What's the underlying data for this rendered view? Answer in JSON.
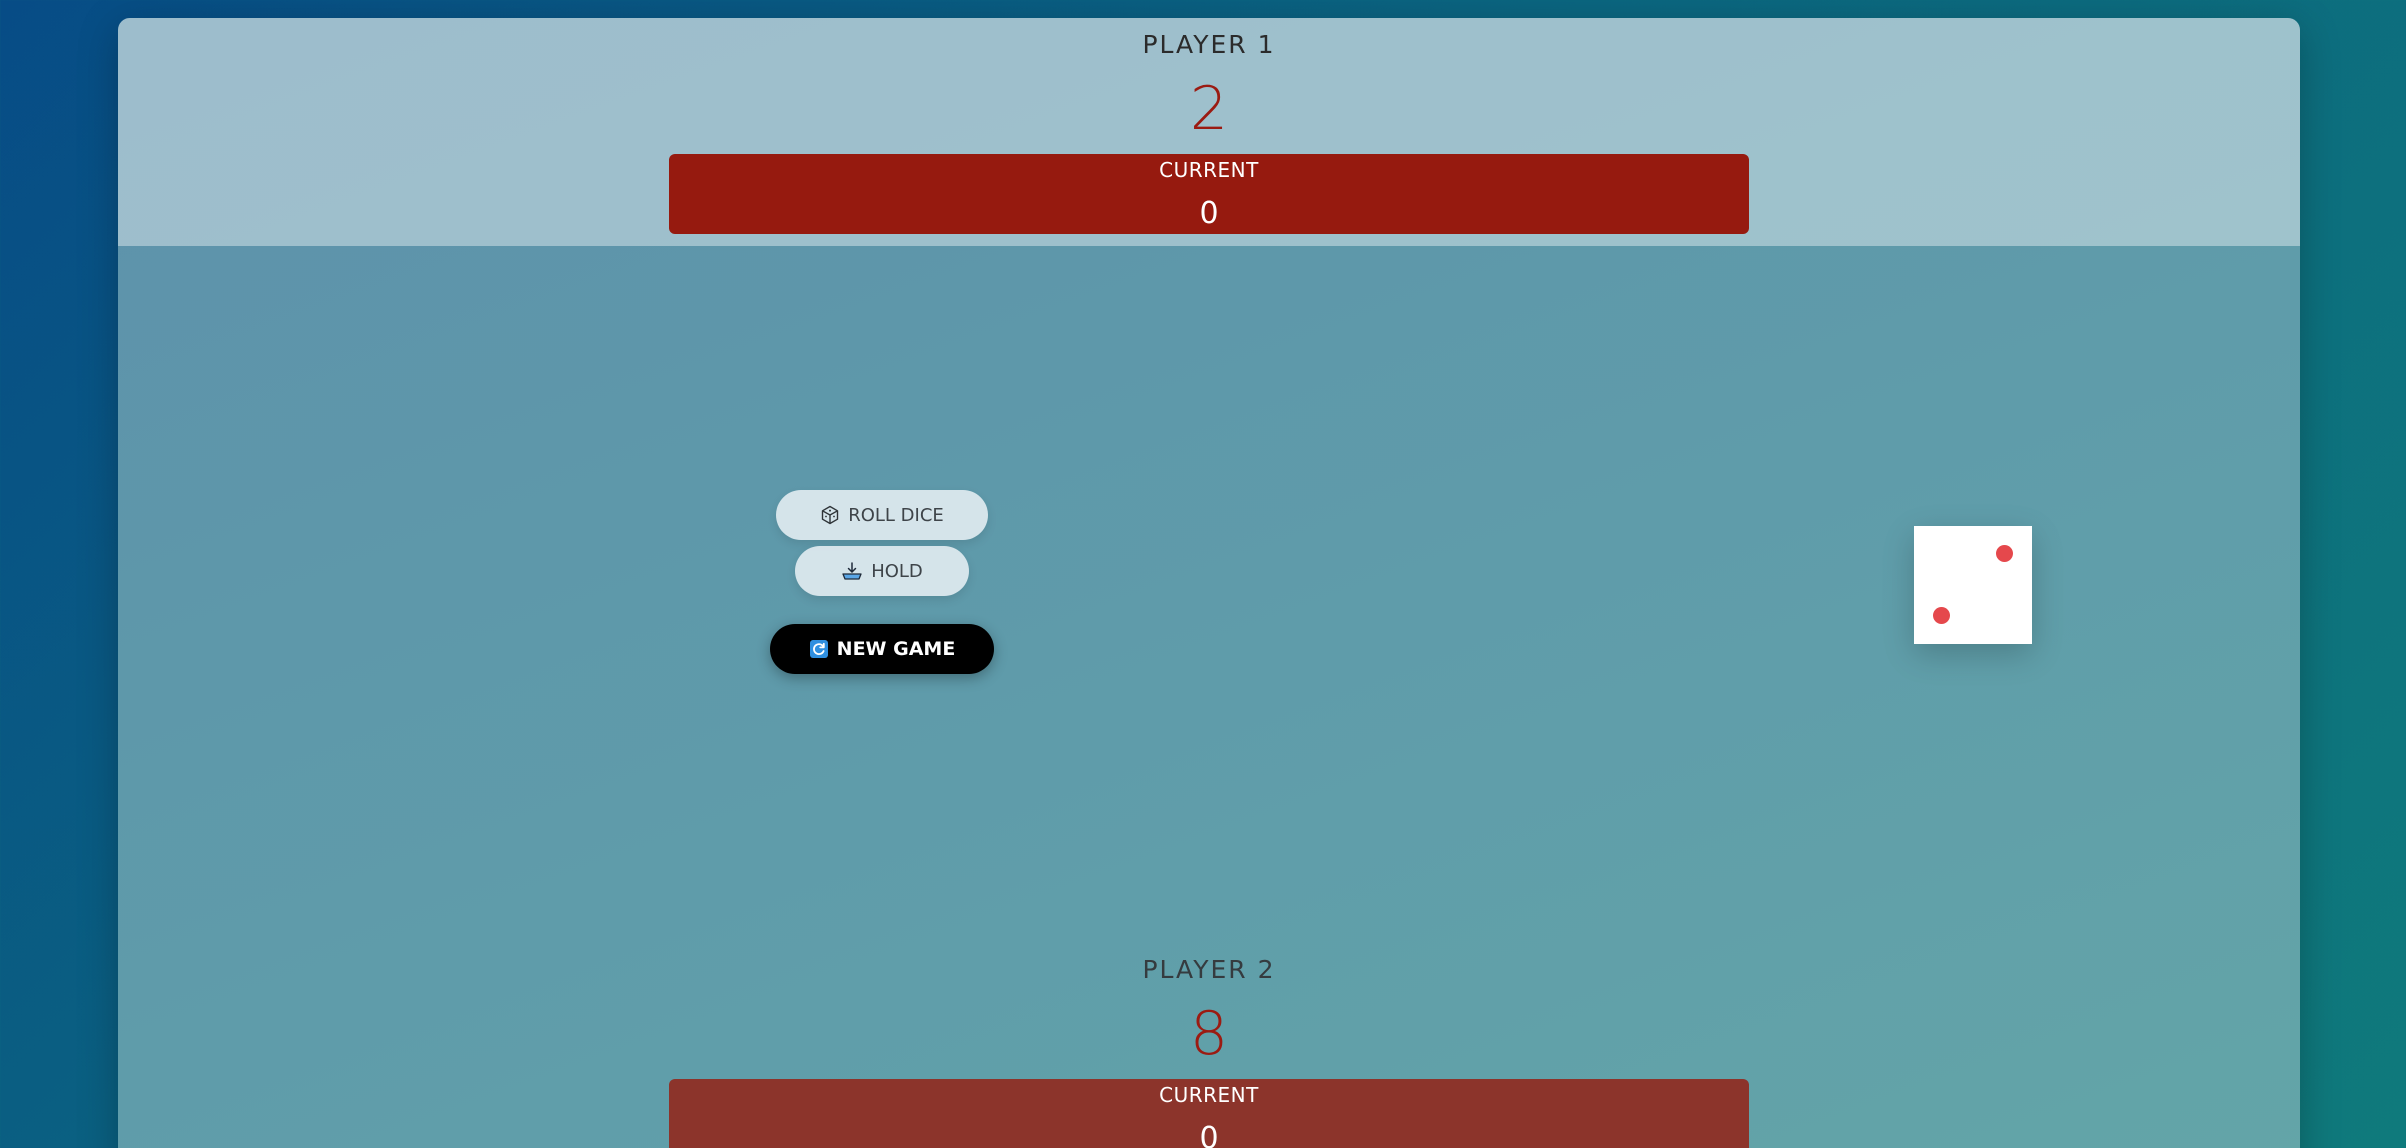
{
  "players": [
    {
      "name": "PLAYER 1",
      "score": "2",
      "current_label": "CURRENT",
      "current_score": "0"
    },
    {
      "name": "PLAYER 2",
      "score": "8",
      "current_label": "CURRENT",
      "current_score": "0"
    }
  ],
  "controls": {
    "roll_label": "ROLL DICE",
    "roll_icon": "dice-icon",
    "hold_label": "HOLD",
    "hold_icon": "hold-icon",
    "new_game_label": "NEW GAME",
    "new_game_icon": "refresh-icon"
  },
  "dice": {
    "value": 2
  },
  "colors": {
    "accent_red": "#961a0f",
    "pip_red": "#e5484c",
    "new_game_bg": "#000000"
  }
}
